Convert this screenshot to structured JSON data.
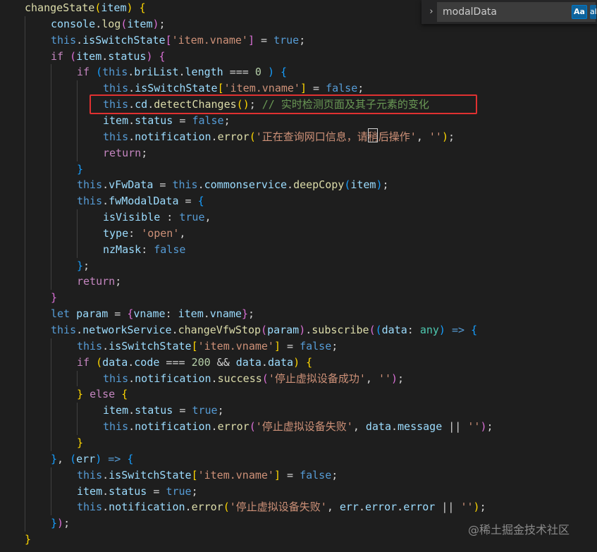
{
  "editor": {
    "colors": {
      "background": "#1e1e1e",
      "keyword": "#569cd6",
      "control": "#c586c0",
      "string": "#ce9178",
      "function": "#dcdcaa",
      "property": "#9cdcfe",
      "comment": "#6a9955",
      "number": "#b5cea8",
      "highlight_box": "#e03131"
    },
    "lines": [
      {
        "indent": 0,
        "tokens": [
          [
            "changeState",
            "fn"
          ],
          [
            "(",
            "br1"
          ],
          [
            "item",
            "var"
          ],
          [
            ")",
            "br1"
          ],
          [
            " ",
            "punc"
          ],
          [
            "{",
            "br1"
          ]
        ]
      },
      {
        "indent": 1,
        "tokens": [
          [
            "console",
            "var"
          ],
          [
            ".",
            "punc"
          ],
          [
            "log",
            "fn"
          ],
          [
            "(",
            "br2"
          ],
          [
            "item",
            "var"
          ],
          [
            ")",
            "br2"
          ],
          [
            ";",
            "punc"
          ]
        ]
      },
      {
        "indent": 1,
        "tokens": [
          [
            "this",
            "this"
          ],
          [
            ".",
            "punc"
          ],
          [
            "isSwitchState",
            "prop"
          ],
          [
            "[",
            "br2"
          ],
          [
            "'item.vname'",
            "str"
          ],
          [
            "]",
            "br2"
          ],
          [
            " = ",
            "op"
          ],
          [
            "true",
            "bool"
          ],
          [
            ";",
            "punc"
          ]
        ]
      },
      {
        "indent": 1,
        "tokens": [
          [
            "if",
            "kw"
          ],
          [
            " ",
            "punc"
          ],
          [
            "(",
            "br2"
          ],
          [
            "item",
            "var"
          ],
          [
            ".",
            "punc"
          ],
          [
            "status",
            "prop"
          ],
          [
            ")",
            "br2"
          ],
          [
            " ",
            "punc"
          ],
          [
            "{",
            "br2"
          ]
        ]
      },
      {
        "indent": 2,
        "tokens": [
          [
            "if",
            "kw"
          ],
          [
            " ",
            "punc"
          ],
          [
            "(",
            "br3"
          ],
          [
            "this",
            "this"
          ],
          [
            ".",
            "punc"
          ],
          [
            "briList",
            "prop"
          ],
          [
            ".",
            "punc"
          ],
          [
            "length",
            "prop"
          ],
          [
            " === ",
            "op"
          ],
          [
            "0",
            "num"
          ],
          [
            " ",
            "punc"
          ],
          [
            ")",
            "br3"
          ],
          [
            " ",
            "punc"
          ],
          [
            "{",
            "br3"
          ]
        ]
      },
      {
        "indent": 3,
        "tokens": [
          [
            "this",
            "this"
          ],
          [
            ".",
            "punc"
          ],
          [
            "isSwitchState",
            "prop"
          ],
          [
            "[",
            "br1"
          ],
          [
            "'item.vname'",
            "str"
          ],
          [
            "]",
            "br1"
          ],
          [
            " = ",
            "op"
          ],
          [
            "false",
            "bool"
          ],
          [
            ";",
            "punc"
          ]
        ]
      },
      {
        "indent": 3,
        "tokens": [
          [
            "this",
            "this"
          ],
          [
            ".",
            "punc"
          ],
          [
            "cd",
            "prop"
          ],
          [
            ".",
            "punc"
          ],
          [
            "detectChanges",
            "fn"
          ],
          [
            "(",
            "br1"
          ],
          [
            ")",
            "br1"
          ],
          [
            "; ",
            "punc"
          ],
          [
            "// 实时检测页面及其子元素的变化",
            "comment"
          ]
        ]
      },
      {
        "indent": 3,
        "tokens": [
          [
            "item",
            "var"
          ],
          [
            ".",
            "punc"
          ],
          [
            "status",
            "prop"
          ],
          [
            " = ",
            "op"
          ],
          [
            "false",
            "bool"
          ],
          [
            ";",
            "punc"
          ]
        ]
      },
      {
        "indent": 3,
        "tokens": [
          [
            "this",
            "this"
          ],
          [
            ".",
            "punc"
          ],
          [
            "notification",
            "prop"
          ],
          [
            ".",
            "punc"
          ],
          [
            "error",
            "fn"
          ],
          [
            "(",
            "br1"
          ],
          [
            "'正在查询网口信息，请稍后操作'",
            "str"
          ],
          [
            ", ",
            "punc"
          ],
          [
            "''",
            "str"
          ],
          [
            ")",
            "br1"
          ],
          [
            ";",
            "punc"
          ]
        ]
      },
      {
        "indent": 3,
        "tokens": [
          [
            "return",
            "kw"
          ],
          [
            ";",
            "punc"
          ]
        ]
      },
      {
        "indent": 2,
        "tokens": [
          [
            "}",
            "br3"
          ]
        ]
      },
      {
        "indent": 2,
        "tokens": [
          [
            "this",
            "this"
          ],
          [
            ".",
            "punc"
          ],
          [
            "vFwData",
            "prop"
          ],
          [
            " = ",
            "op"
          ],
          [
            "this",
            "this"
          ],
          [
            ".",
            "punc"
          ],
          [
            "commonservice",
            "prop"
          ],
          [
            ".",
            "punc"
          ],
          [
            "deepCopy",
            "fn"
          ],
          [
            "(",
            "br3"
          ],
          [
            "item",
            "var"
          ],
          [
            ")",
            "br3"
          ],
          [
            ";",
            "punc"
          ]
        ]
      },
      {
        "indent": 2,
        "tokens": [
          [
            "this",
            "this"
          ],
          [
            ".",
            "punc"
          ],
          [
            "fwModalData",
            "prop"
          ],
          [
            " = ",
            "op"
          ],
          [
            "{",
            "br3"
          ]
        ]
      },
      {
        "indent": 3,
        "tokens": [
          [
            "isVisible",
            "prop"
          ],
          [
            " : ",
            "punc"
          ],
          [
            "true",
            "bool"
          ],
          [
            ",",
            "punc"
          ]
        ]
      },
      {
        "indent": 3,
        "tokens": [
          [
            "type",
            "prop"
          ],
          [
            ": ",
            "punc"
          ],
          [
            "'open'",
            "str"
          ],
          [
            ",",
            "punc"
          ]
        ]
      },
      {
        "indent": 3,
        "tokens": [
          [
            "nzMask",
            "prop"
          ],
          [
            ": ",
            "punc"
          ],
          [
            "false",
            "bool"
          ]
        ]
      },
      {
        "indent": 2,
        "tokens": [
          [
            "}",
            "br3"
          ],
          [
            ";",
            "punc"
          ]
        ]
      },
      {
        "indent": 2,
        "tokens": [
          [
            "return",
            "kw"
          ],
          [
            ";",
            "punc"
          ]
        ]
      },
      {
        "indent": 1,
        "tokens": [
          [
            "}",
            "br2"
          ]
        ]
      },
      {
        "indent": 1,
        "tokens": [
          [
            "let",
            "decl"
          ],
          [
            " ",
            "punc"
          ],
          [
            "param",
            "var"
          ],
          [
            " = ",
            "op"
          ],
          [
            "{",
            "br2"
          ],
          [
            "vname",
            "prop"
          ],
          [
            ": ",
            "punc"
          ],
          [
            "item",
            "var"
          ],
          [
            ".",
            "punc"
          ],
          [
            "vname",
            "prop"
          ],
          [
            "}",
            "br2"
          ],
          [
            ";",
            "punc"
          ]
        ]
      },
      {
        "indent": 1,
        "tokens": [
          [
            "this",
            "this"
          ],
          [
            ".",
            "punc"
          ],
          [
            "networkService",
            "prop"
          ],
          [
            ".",
            "punc"
          ],
          [
            "changeVfwStop",
            "fn"
          ],
          [
            "(",
            "br2"
          ],
          [
            "param",
            "var"
          ],
          [
            ")",
            "br2"
          ],
          [
            ".",
            "punc"
          ],
          [
            "subscribe",
            "fn"
          ],
          [
            "(",
            "br2"
          ],
          [
            "(",
            "br3"
          ],
          [
            "data",
            "var"
          ],
          [
            ": ",
            "punc"
          ],
          [
            "any",
            "type"
          ],
          [
            ")",
            "br3"
          ],
          [
            " => ",
            "decl"
          ],
          [
            "{",
            "br3"
          ]
        ]
      },
      {
        "indent": 2,
        "tokens": [
          [
            "this",
            "this"
          ],
          [
            ".",
            "punc"
          ],
          [
            "isSwitchState",
            "prop"
          ],
          [
            "[",
            "br1"
          ],
          [
            "'item.vname'",
            "str"
          ],
          [
            "]",
            "br1"
          ],
          [
            " = ",
            "op"
          ],
          [
            "false",
            "bool"
          ],
          [
            ";",
            "punc"
          ]
        ]
      },
      {
        "indent": 2,
        "tokens": [
          [
            "if",
            "kw"
          ],
          [
            " ",
            "punc"
          ],
          [
            "(",
            "br1"
          ],
          [
            "data",
            "var"
          ],
          [
            ".",
            "punc"
          ],
          [
            "code",
            "prop"
          ],
          [
            " === ",
            "op"
          ],
          [
            "200",
            "num"
          ],
          [
            " && ",
            "op"
          ],
          [
            "data",
            "var"
          ],
          [
            ".",
            "punc"
          ],
          [
            "data",
            "prop"
          ],
          [
            ")",
            "br1"
          ],
          [
            " ",
            "punc"
          ],
          [
            "{",
            "br1"
          ]
        ]
      },
      {
        "indent": 3,
        "tokens": [
          [
            "this",
            "this"
          ],
          [
            ".",
            "punc"
          ],
          [
            "notification",
            "prop"
          ],
          [
            ".",
            "punc"
          ],
          [
            "success",
            "fn"
          ],
          [
            "(",
            "br2"
          ],
          [
            "'停止虚拟设备成功'",
            "str"
          ],
          [
            ", ",
            "punc"
          ],
          [
            "''",
            "str"
          ],
          [
            ")",
            "br2"
          ],
          [
            ";",
            "punc"
          ]
        ]
      },
      {
        "indent": 2,
        "tokens": [
          [
            "}",
            "br1"
          ],
          [
            " ",
            "punc"
          ],
          [
            "else",
            "kw"
          ],
          [
            " ",
            "punc"
          ],
          [
            "{",
            "br1"
          ]
        ]
      },
      {
        "indent": 3,
        "tokens": [
          [
            "item",
            "var"
          ],
          [
            ".",
            "punc"
          ],
          [
            "status",
            "prop"
          ],
          [
            " = ",
            "op"
          ],
          [
            "true",
            "bool"
          ],
          [
            ";",
            "punc"
          ]
        ]
      },
      {
        "indent": 3,
        "tokens": [
          [
            "this",
            "this"
          ],
          [
            ".",
            "punc"
          ],
          [
            "notification",
            "prop"
          ],
          [
            ".",
            "punc"
          ],
          [
            "error",
            "fn"
          ],
          [
            "(",
            "br2"
          ],
          [
            "'停止虚拟设备失败'",
            "str"
          ],
          [
            ", ",
            "punc"
          ],
          [
            "data",
            "var"
          ],
          [
            ".",
            "punc"
          ],
          [
            "message",
            "prop"
          ],
          [
            " || ",
            "op"
          ],
          [
            "''",
            "str"
          ],
          [
            ")",
            "br2"
          ],
          [
            ";",
            "punc"
          ]
        ]
      },
      {
        "indent": 2,
        "tokens": [
          [
            "}",
            "br1"
          ]
        ]
      },
      {
        "indent": 1,
        "tokens": [
          [
            "}",
            "br3"
          ],
          [
            ", ",
            "punc"
          ],
          [
            "(",
            "br3"
          ],
          [
            "err",
            "var"
          ],
          [
            ")",
            "br3"
          ],
          [
            " => ",
            "decl"
          ],
          [
            "{",
            "br3"
          ]
        ]
      },
      {
        "indent": 2,
        "tokens": [
          [
            "this",
            "this"
          ],
          [
            ".",
            "punc"
          ],
          [
            "isSwitchState",
            "prop"
          ],
          [
            "[",
            "br1"
          ],
          [
            "'item.vname'",
            "str"
          ],
          [
            "]",
            "br1"
          ],
          [
            " = ",
            "op"
          ],
          [
            "false",
            "bool"
          ],
          [
            ";",
            "punc"
          ]
        ]
      },
      {
        "indent": 2,
        "tokens": [
          [
            "item",
            "var"
          ],
          [
            ".",
            "punc"
          ],
          [
            "status",
            "prop"
          ],
          [
            " = ",
            "op"
          ],
          [
            "true",
            "bool"
          ],
          [
            ";",
            "punc"
          ]
        ]
      },
      {
        "indent": 2,
        "tokens": [
          [
            "this",
            "this"
          ],
          [
            ".",
            "punc"
          ],
          [
            "notification",
            "prop"
          ],
          [
            ".",
            "punc"
          ],
          [
            "error",
            "fn"
          ],
          [
            "(",
            "br1"
          ],
          [
            "'停止虚拟设备失败'",
            "str"
          ],
          [
            ", ",
            "punc"
          ],
          [
            "err",
            "var"
          ],
          [
            ".",
            "punc"
          ],
          [
            "error",
            "prop"
          ],
          [
            ".",
            "punc"
          ],
          [
            "error",
            "prop"
          ],
          [
            " || ",
            "op"
          ],
          [
            "''",
            "str"
          ],
          [
            ")",
            "br1"
          ],
          [
            ";",
            "punc"
          ]
        ]
      },
      {
        "indent": 1,
        "tokens": [
          [
            "}",
            "br3"
          ],
          [
            ")",
            "br2"
          ],
          [
            ";",
            "punc"
          ]
        ]
      },
      {
        "indent": 0,
        "tokens": [
          [
            "}",
            "br1"
          ]
        ]
      }
    ]
  },
  "find_widget": {
    "toggle_icon": "chevron-right-icon",
    "query": "modalData",
    "match_case_label": "Aa",
    "whole_word_label": "ab"
  },
  "watermark": "@稀土掘金技术社区"
}
